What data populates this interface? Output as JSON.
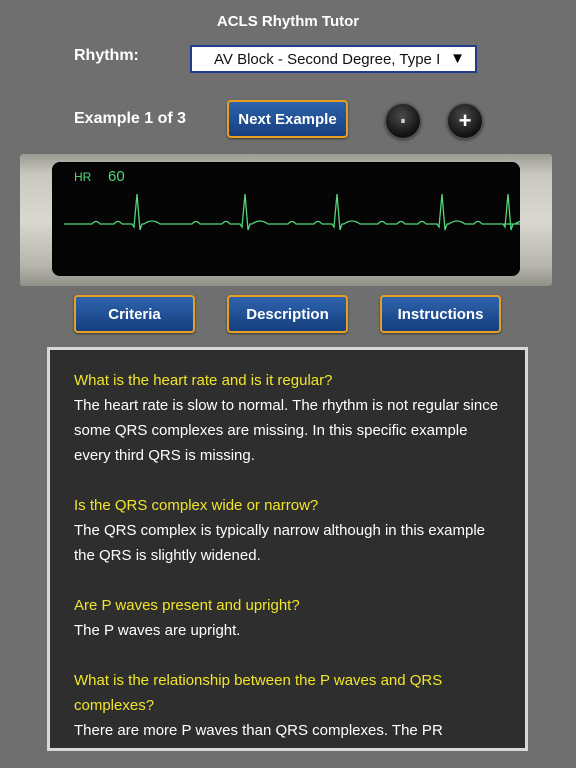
{
  "header": {
    "title": "ACLS Rhythm Tutor"
  },
  "rhythm": {
    "label": "Rhythm:",
    "selected": "AV Block - Second Degree, Type I",
    "arrow": "▼"
  },
  "example": {
    "counter": "Example 1 of 3",
    "next_label": "Next Example"
  },
  "controls": {
    "pause_glyph": "⏸",
    "plus_glyph": "+"
  },
  "monitor": {
    "hr_label": "HR",
    "hr_value": "60",
    "trace_color": "#55d67a"
  },
  "tabs": [
    {
      "label": "Criteria"
    },
    {
      "label": "Description"
    },
    {
      "label": "Instructions"
    }
  ],
  "criteria": [
    {
      "question": "What is the heart rate and is it regular?",
      "answer": "The heart rate is slow to normal. The rhythm is not regular since some QRS complexes are missing. In this specific example every third QRS is missing."
    },
    {
      "question": "Is the QRS complex wide or narrow?",
      "answer": "The QRS complex is typically narrow although in this example the QRS is slightly widened."
    },
    {
      "question": "Are P waves present and upright?",
      "answer": "The P waves are upright."
    },
    {
      "question": "What is the relationship between the P waves and QRS complexes?",
      "answer": "There are more P waves than QRS complexes. The PR"
    }
  ],
  "colors": {
    "accent": "#e6a020",
    "button": "#1f4f96",
    "question": "#f1e52a"
  }
}
